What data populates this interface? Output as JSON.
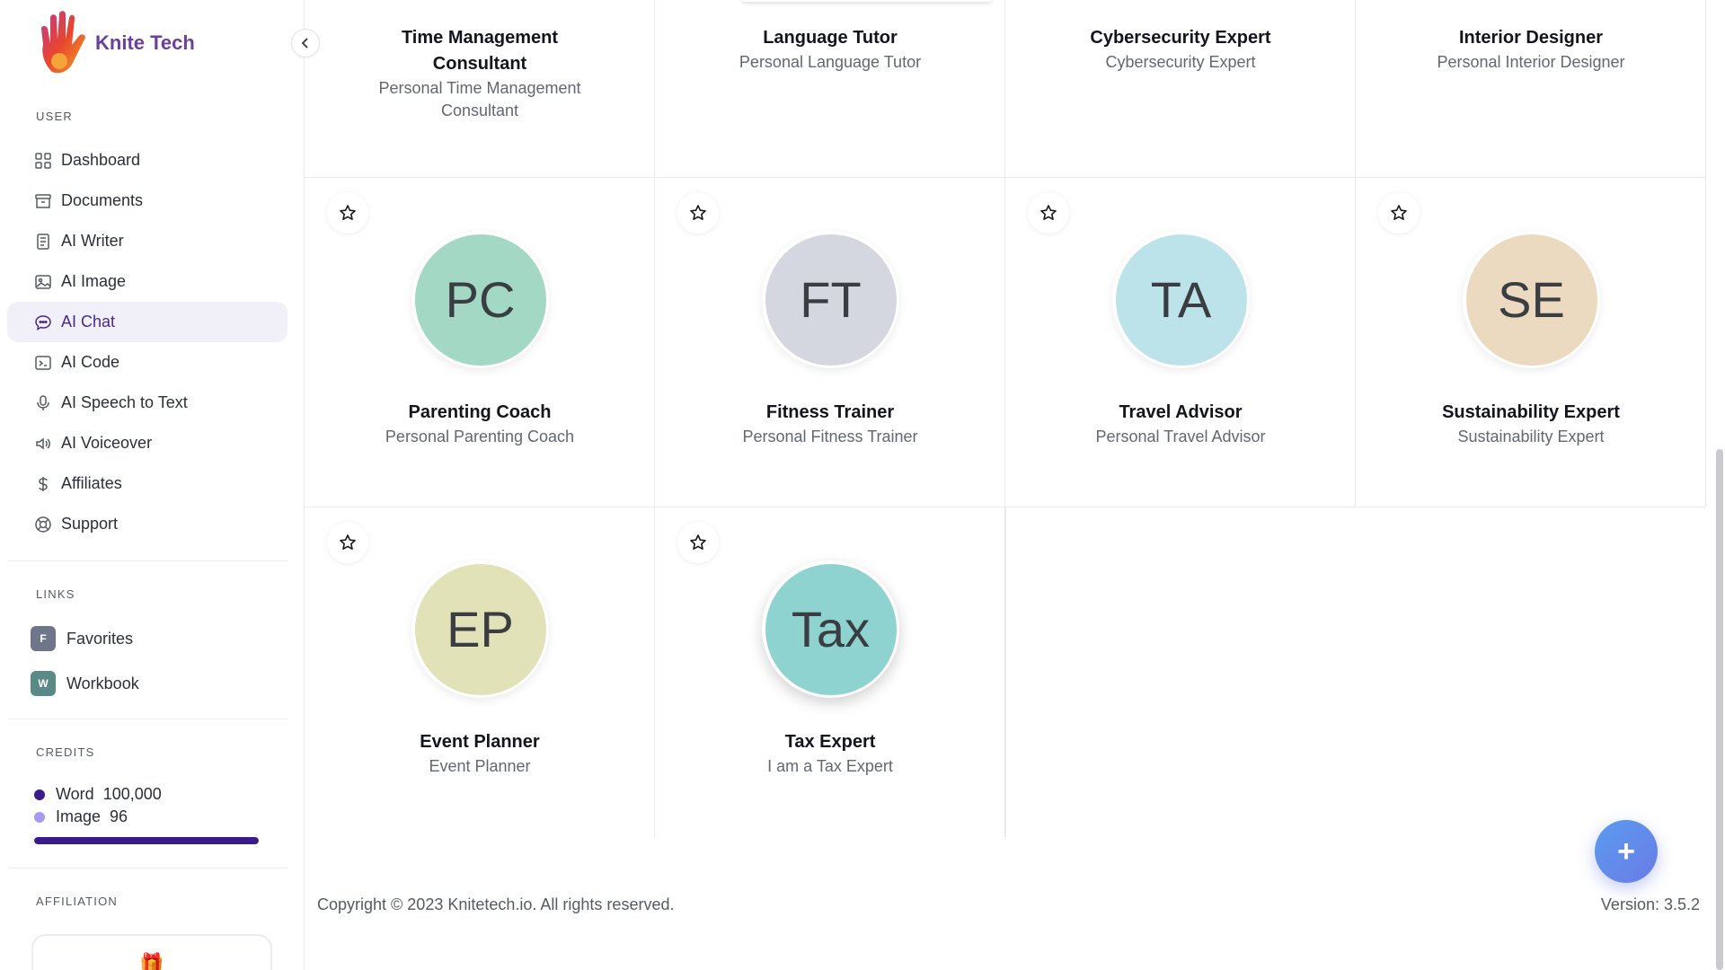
{
  "brand": {
    "name": "Knite Tech"
  },
  "sidebar": {
    "user_label": "USER",
    "items": [
      {
        "label": "Dashboard",
        "icon": "grid-icon"
      },
      {
        "label": "Documents",
        "icon": "archive-icon"
      },
      {
        "label": "AI Writer",
        "icon": "document-icon"
      },
      {
        "label": "AI Image",
        "icon": "image-icon"
      },
      {
        "label": "AI Chat",
        "icon": "chat-icon",
        "active": true
      },
      {
        "label": "AI Code",
        "icon": "terminal-icon"
      },
      {
        "label": "AI Speech to Text",
        "icon": "microphone-icon"
      },
      {
        "label": "AI Voiceover",
        "icon": "speaker-icon"
      },
      {
        "label": "Affiliates",
        "icon": "dollar-icon"
      },
      {
        "label": "Support",
        "icon": "lifebuoy-icon"
      }
    ],
    "links_label": "LINKS",
    "links": [
      {
        "badge": "F",
        "label": "Favorites",
        "color": "#6f7689"
      },
      {
        "badge": "W",
        "label": "Workbook",
        "color": "#5a8a86"
      }
    ],
    "credits_label": "CREDITS",
    "credits": [
      {
        "name": "Word",
        "value": "100,000",
        "color": "#3b1a8a"
      },
      {
        "name": "Image",
        "value": "96",
        "color": "#a99af0"
      }
    ],
    "credits_progress": 1.0,
    "affiliation_label": "AFFILIATION"
  },
  "top_cards": [
    {
      "title": "Time Management Consultant",
      "subtitle": "Personal Time Management Consultant"
    },
    {
      "title": "Language Tutor",
      "subtitle": "Personal Language Tutor"
    },
    {
      "title": "Cybersecurity Expert",
      "subtitle": "Cybersecurity Expert"
    },
    {
      "title": "Interior Designer",
      "subtitle": "Personal Interior Designer"
    }
  ],
  "cards": [
    {
      "initials": "PC",
      "title": "Parenting Coach",
      "subtitle": "Personal Parenting Coach",
      "color": "#a3d9c4"
    },
    {
      "initials": "FT",
      "title": "Fitness Trainer",
      "subtitle": "Personal Fitness Trainer",
      "color": "#d4d7e0"
    },
    {
      "initials": "TA",
      "title": "Travel Advisor",
      "subtitle": "Personal Travel Advisor",
      "color": "#bde3ea"
    },
    {
      "initials": "SE",
      "title": "Sustainability Expert",
      "subtitle": "Sustainability Expert",
      "color": "#ebdac0"
    },
    {
      "initials": "EP",
      "title": "Event Planner",
      "subtitle": "Event Planner",
      "color": "#e2e2b9"
    },
    {
      "initials": "Tax",
      "title": "Tax Expert",
      "subtitle": "I am a Tax Expert",
      "color": "#8ed3d0"
    }
  ],
  "footer": {
    "copyright": "Copyright © 2023 Knitetech.io. All rights reserved.",
    "version": "Version: 3.5.2"
  },
  "fab_symbol": "+"
}
